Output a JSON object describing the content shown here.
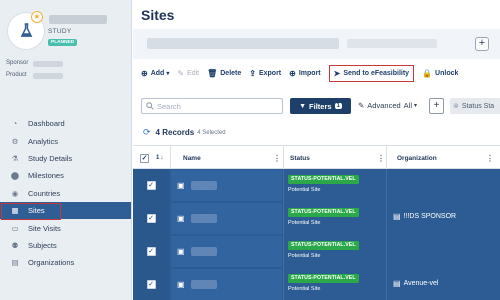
{
  "study": {
    "type_label": "STUDY",
    "status_badge": "PLANNED",
    "sponsor_label": "Sponsor",
    "product_label": "Product"
  },
  "sidebar": {
    "items": [
      {
        "label": "Dashboard",
        "icon": "dashboard-icon",
        "glyph": "◔"
      },
      {
        "label": "Analytics",
        "icon": "analytics-icon",
        "glyph": "⚙"
      },
      {
        "label": "Study Details",
        "icon": "study-details-icon",
        "glyph": "⚗"
      },
      {
        "label": "Milestones",
        "icon": "milestone-pin-icon",
        "glyph": "⬤"
      },
      {
        "label": "Countries",
        "icon": "globe-icon",
        "glyph": "◉"
      },
      {
        "label": "Sites",
        "icon": "sites-icon",
        "glyph": "▦",
        "active": true
      },
      {
        "label": "Site Visits",
        "icon": "site-visits-icon",
        "glyph": "▭"
      },
      {
        "label": "Subjects",
        "icon": "subjects-icon",
        "glyph": "⚉"
      },
      {
        "label": "Organizations",
        "icon": "organizations-icon",
        "glyph": "▤"
      }
    ]
  },
  "header": {
    "title": "Sites",
    "add_symbol": "+"
  },
  "toolbar": {
    "add": "Add",
    "add_caret": "▾",
    "edit": "Edit",
    "delete": "Delete",
    "export": "Export",
    "import": "Import",
    "send": "Send to eFeasibility",
    "unlock": "Unlock"
  },
  "filters": {
    "search_placeholder": "Search",
    "filters_label": "Filters",
    "filters_count": "1",
    "advanced_label": "Advanced",
    "advanced_value": "All",
    "add_symbol": "+",
    "status_chip": "Status Sta"
  },
  "records": {
    "count": "4 Records",
    "selected": "4 Selected"
  },
  "table": {
    "sort_number": "1",
    "sort_arrow": "↓",
    "columns": {
      "name": "Name",
      "status": "Status",
      "organization": "Organization"
    },
    "rows": [
      {
        "status": "STATUS-POTENTIAL.VEL",
        "status_sub": "Potential Site",
        "org": ""
      },
      {
        "status": "STATUS-POTENTIAL.VEL",
        "status_sub": "Potential Site",
        "org": "!!!DS SPONSOR"
      },
      {
        "status": "STATUS-POTENTIAL.VEL",
        "status_sub": "Potential Site",
        "org": ""
      },
      {
        "status": "STATUS-POTENTIAL.VEL",
        "status_sub": "Potential Site",
        "org": "Avenue-vel"
      }
    ]
  },
  "colors": {
    "active_nav": "#2f5d95",
    "primary": "#1f3f6b",
    "status_green": "#2aa84a",
    "highlight_red": "#c43a3a",
    "selected_row": "#2c5c93"
  }
}
